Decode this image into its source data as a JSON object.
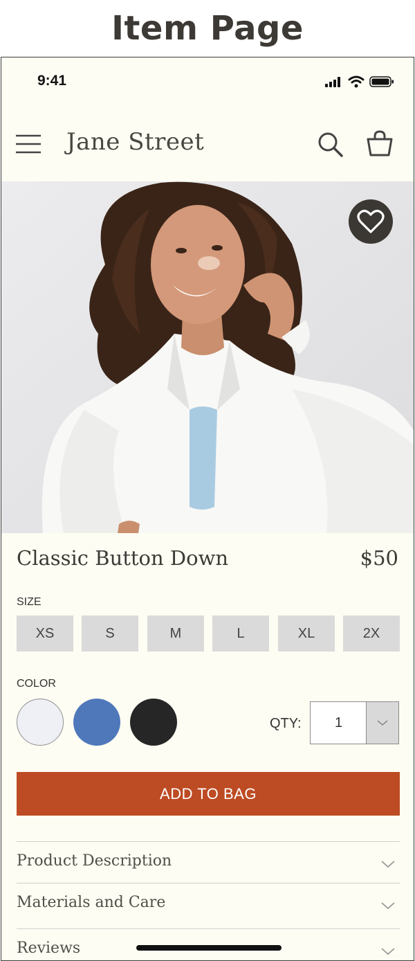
{
  "page_heading": "Item Page",
  "status_bar": {
    "time": "9:41"
  },
  "nav": {
    "brand": "Jane Street"
  },
  "product": {
    "name": "Classic Button Down",
    "price": "$50"
  },
  "size": {
    "label": "SIZE",
    "options": [
      "XS",
      "S",
      "M",
      "L",
      "XL",
      "2X"
    ]
  },
  "color": {
    "label": "COLOR",
    "swatches": [
      {
        "name": "white",
        "hex": "#eef0f5"
      },
      {
        "name": "blue",
        "hex": "#4f78bb"
      },
      {
        "name": "black",
        "hex": "#262626"
      }
    ]
  },
  "quantity": {
    "label": "QTY:",
    "value": "1"
  },
  "add_to_bag_label": "ADD TO BAG",
  "accordion": [
    {
      "label": "Product Description"
    },
    {
      "label": "Materials and Care"
    },
    {
      "label": "Reviews"
    }
  ],
  "colors": {
    "accent": "#bd4b23",
    "background": "#fdfdf3",
    "favorite_button": "#3b3833"
  },
  "icons": [
    "menu-icon",
    "search-icon",
    "bag-icon",
    "heart-icon",
    "chevron-down-icon",
    "signal-icon",
    "wifi-icon",
    "battery-icon"
  ]
}
